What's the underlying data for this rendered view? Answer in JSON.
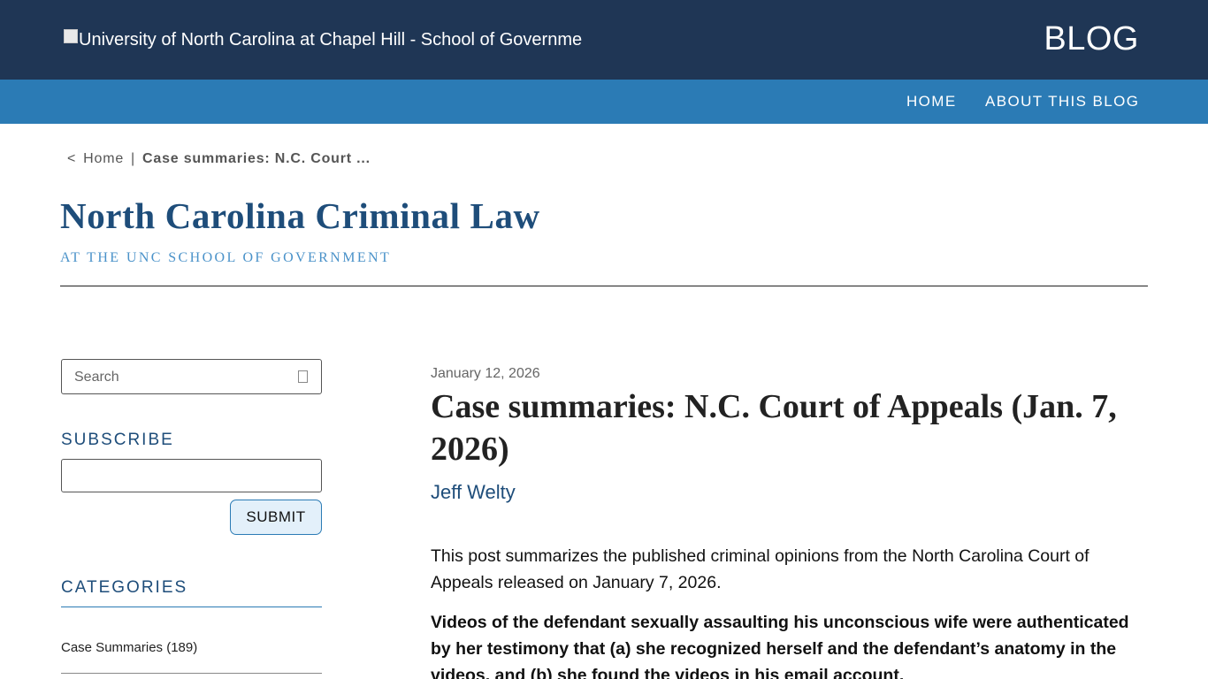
{
  "header": {
    "logo_alt": "University of North Carolina at Chapel Hill - School of Governme",
    "blog_label": "BLOG"
  },
  "nav": {
    "items": [
      {
        "label": "HOME"
      },
      {
        "label": "ABOUT THIS BLOG"
      }
    ]
  },
  "breadcrumb": {
    "chevron": "<",
    "home": "Home",
    "separator": "|",
    "current": "Case summaries: N.C. Court ..."
  },
  "site": {
    "title": "North Carolina Criminal Law",
    "subtitle": "AT THE UNC SCHOOL OF GOVERNMENT"
  },
  "sidebar": {
    "search_placeholder": "Search",
    "subscribe_heading": "SUBSCRIBE",
    "subscribe_value": "",
    "submit_label": "SUBMIT",
    "categories_heading": "CATEGORIES",
    "categories": [
      {
        "label": "Case Summaries (189)"
      }
    ]
  },
  "post": {
    "date": "January 12, 2026",
    "title": "Case summaries: N.C. Court of Appeals (Jan. 7, 2026)",
    "author": "Jeff Welty",
    "intro": "This post summarizes the published criminal opinions from the North Carolina Court of Appeals released on January 7, 2026.",
    "bold_lead": "Videos of the defendant sexually assaulting his unconscious wife were authenticated by her testimony that (a) she recognized herself and the defendant’s anatomy in the videos, and (b) she found the videos in his email account."
  },
  "colors": {
    "topbar": "#1f3655",
    "navbar": "#2b7bb5",
    "title_blue": "#1e4d7a",
    "subtitle_blue": "#4a92c9",
    "submit_bg": "#e3f0fa"
  },
  "icons": {
    "search": "search-icon",
    "logo": "broken-image-icon"
  }
}
